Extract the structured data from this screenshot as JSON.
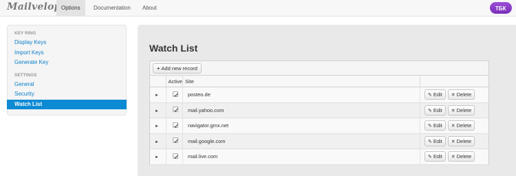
{
  "navbar": {
    "brand": "Mailvelope",
    "tabs": [
      {
        "label": "Options",
        "active": true
      },
      {
        "label": "Documentation",
        "active": false
      },
      {
        "label": "About",
        "active": false
      }
    ],
    "lock_icon": "lock-icon",
    "accent_color": "#8a2be2"
  },
  "sidebar": {
    "sections": [
      {
        "header": "KEY RING",
        "items": [
          "Display Keys",
          "Import Keys",
          "Generate Key"
        ]
      },
      {
        "header": "SETTINGS",
        "items": [
          "General",
          "Security",
          "Watch List"
        ]
      }
    ],
    "active_item": "Watch List",
    "active_color": "#0d8ad4",
    "link_color": "#0a7ecb"
  },
  "main": {
    "title": "Watch List",
    "add_button": "Add new record",
    "columns": {
      "active": "Active",
      "site": "Site"
    },
    "edit_label": "Edit",
    "delete_label": "Delete",
    "rows": [
      {
        "site": "posteo.de",
        "active": true
      },
      {
        "site": "mail.yahoo.com",
        "active": true
      },
      {
        "site": "navigator.gmx.net",
        "active": true
      },
      {
        "site": "mail.google.com",
        "active": true
      },
      {
        "site": "mail.live.com",
        "active": true
      }
    ]
  }
}
